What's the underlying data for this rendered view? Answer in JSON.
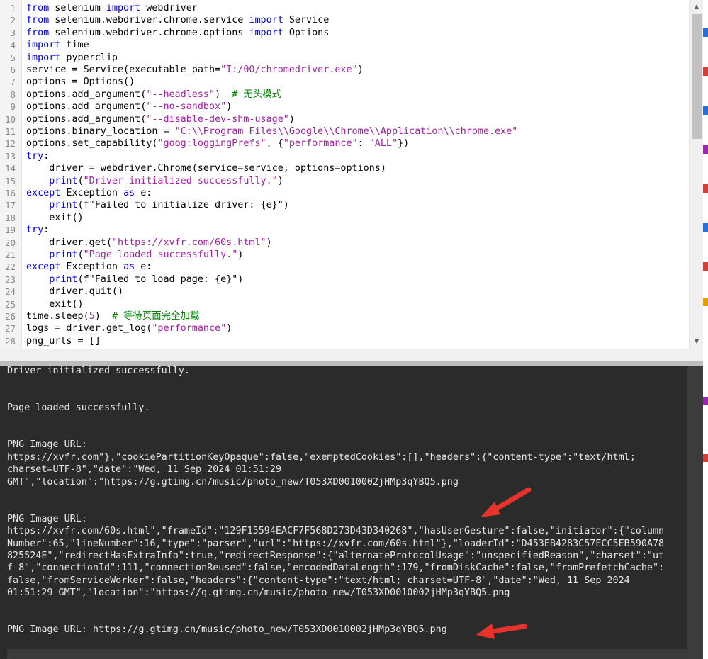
{
  "editor": {
    "lines": [
      {
        "n": "1",
        "tokens": [
          [
            "kw",
            "from"
          ],
          [
            "pl",
            " selenium "
          ],
          [
            "kw",
            "import"
          ],
          [
            "pl",
            " webdriver"
          ]
        ]
      },
      {
        "n": "2",
        "tokens": [
          [
            "kw",
            "from"
          ],
          [
            "pl",
            " selenium.webdriver.chrome.service "
          ],
          [
            "kw",
            "import"
          ],
          [
            "pl",
            " Service"
          ]
        ]
      },
      {
        "n": "3",
        "tokens": [
          [
            "kw",
            "from"
          ],
          [
            "pl",
            " selenium.webdriver.chrome.options "
          ],
          [
            "kw",
            "import"
          ],
          [
            "pl",
            " Options"
          ]
        ]
      },
      {
        "n": "4",
        "tokens": [
          [
            "kw",
            "import"
          ],
          [
            "pl",
            " time"
          ]
        ]
      },
      {
        "n": "5",
        "tokens": [
          [
            "kw",
            "import"
          ],
          [
            "pl",
            " pyperclip"
          ]
        ]
      },
      {
        "n": "6",
        "tokens": [
          [
            "pl",
            "service = Service(executable_path="
          ],
          [
            "str",
            "\"I:/00/chromedriver.exe\""
          ],
          [
            "pl",
            ")"
          ]
        ]
      },
      {
        "n": "7",
        "tokens": [
          [
            "pl",
            "options = Options()"
          ]
        ]
      },
      {
        "n": "8",
        "tokens": [
          [
            "pl",
            "options.add_argument("
          ],
          [
            "str",
            "\"--headless\""
          ],
          [
            "pl",
            ")  "
          ],
          [
            "cmt",
            "# 无头模式"
          ]
        ]
      },
      {
        "n": "9",
        "tokens": [
          [
            "pl",
            "options.add_argument("
          ],
          [
            "str",
            "\"--no-sandbox\""
          ],
          [
            "pl",
            ")"
          ]
        ]
      },
      {
        "n": "10",
        "tokens": [
          [
            "pl",
            "options.add_argument("
          ],
          [
            "str",
            "\"--disable-dev-shm-usage\""
          ],
          [
            "pl",
            ")"
          ]
        ]
      },
      {
        "n": "11",
        "tokens": [
          [
            "pl",
            "options.binary_location = "
          ],
          [
            "str",
            "\"C:\\\\Program Files\\\\Google\\\\Chrome\\\\Application\\\\chrome.exe\""
          ]
        ]
      },
      {
        "n": "12",
        "tokens": [
          [
            "pl",
            "options.set_capability("
          ],
          [
            "str",
            "\"goog:loggingPrefs\""
          ],
          [
            "pl",
            ", {"
          ],
          [
            "str",
            "\"performance\""
          ],
          [
            "pl",
            ": "
          ],
          [
            "str",
            "\"ALL\""
          ],
          [
            "pl",
            "})"
          ]
        ]
      },
      {
        "n": "13",
        "tokens": [
          [
            "kw",
            "try"
          ],
          [
            "pl",
            ":"
          ]
        ]
      },
      {
        "n": "14",
        "tokens": [
          [
            "pl",
            "    driver = webdriver.Chrome(service=service, options=options)"
          ]
        ]
      },
      {
        "n": "15",
        "tokens": [
          [
            "pl",
            "    "
          ],
          [
            "bi",
            "print"
          ],
          [
            "pl",
            "("
          ],
          [
            "str",
            "\"Driver initialized successfully.\""
          ],
          [
            "pl",
            ")"
          ]
        ]
      },
      {
        "n": "16",
        "tokens": [
          [
            "kw",
            "except"
          ],
          [
            "pl",
            " Exception "
          ],
          [
            "kw",
            "as"
          ],
          [
            "pl",
            " e:"
          ]
        ]
      },
      {
        "n": "17",
        "tokens": [
          [
            "pl",
            "    "
          ],
          [
            "bi",
            "print"
          ],
          [
            "pl",
            "(f\"Failed to initialize driver: {e}\")"
          ]
        ]
      },
      {
        "n": "18",
        "tokens": [
          [
            "pl",
            "    exit()"
          ]
        ]
      },
      {
        "n": "19",
        "tokens": [
          [
            "kw",
            "try"
          ],
          [
            "pl",
            ":"
          ]
        ]
      },
      {
        "n": "20",
        "tokens": [
          [
            "pl",
            "    driver.get("
          ],
          [
            "str",
            "\"https://xvfr.com/60s.html\""
          ],
          [
            "pl",
            ")"
          ]
        ]
      },
      {
        "n": "21",
        "tokens": [
          [
            "pl",
            "    "
          ],
          [
            "bi",
            "print"
          ],
          [
            "pl",
            "("
          ],
          [
            "str",
            "\"Page loaded successfully.\""
          ],
          [
            "pl",
            ")"
          ]
        ]
      },
      {
        "n": "22",
        "tokens": [
          [
            "kw",
            "except"
          ],
          [
            "pl",
            " Exception "
          ],
          [
            "kw",
            "as"
          ],
          [
            "pl",
            " e:"
          ]
        ]
      },
      {
        "n": "23",
        "tokens": [
          [
            "pl",
            "    "
          ],
          [
            "bi",
            "print"
          ],
          [
            "pl",
            "(f\"Failed to load page: {e}\")"
          ]
        ]
      },
      {
        "n": "24",
        "tokens": [
          [
            "pl",
            "    driver.quit()"
          ]
        ]
      },
      {
        "n": "25",
        "tokens": [
          [
            "pl",
            "    exit()"
          ]
        ]
      },
      {
        "n": "26",
        "tokens": [
          [
            "pl",
            "time.sleep("
          ],
          [
            "num",
            "5"
          ],
          [
            "pl",
            ")  "
          ],
          [
            "cmt",
            "# 等待页面完全加载"
          ]
        ]
      },
      {
        "n": "27",
        "tokens": [
          [
            "pl",
            "logs = driver.get_log("
          ],
          [
            "str",
            "\"performance\""
          ],
          [
            "pl",
            ")"
          ]
        ]
      },
      {
        "n": "28",
        "tokens": [
          [
            "pl",
            "png_urls = []"
          ]
        ]
      }
    ],
    "scroll_up_icon": "triangle-up",
    "scroll_down_icon": "triangle-down"
  },
  "console": {
    "lines": [
      "Driver initialized successfully.",
      "",
      "",
      "Page loaded successfully.",
      "",
      "",
      "PNG Image URL:",
      "https://xvfr.com\"},\"cookiePartitionKeyOpaque\":false,\"exemptedCookies\":[],\"headers\":{\"content-type\":\"text/html;",
      "charset=UTF-8\",\"date\":\"Wed, 11 Sep 2024 01:51:29",
      "GMT\",\"location\":\"https://g.gtimg.cn/music/photo_new/T053XD0010002jHMp3qYBQ5.png",
      "",
      "",
      "PNG Image URL:",
      "https://xvfr.com/60s.html\",\"frameId\":\"129F15594EACF7F568D273D43D340268\",\"hasUserGesture\":false,\"initiator\":{\"column",
      "Number\":65,\"lineNumber\":16,\"type\":\"parser\",\"url\":\"https://xvfr.com/60s.html\"},\"loaderId\":\"D453EB4283C57ECC5EB590A78",
      "825524E\",\"redirectHasExtraInfo\":true,\"redirectResponse\":{\"alternateProtocolUsage\":\"unspecifiedReason\",\"charset\":\"ut",
      "f-8\",\"connectionId\":111,\"connectionReused\":false,\"encodedDataLength\":179,\"fromDiskCache\":false,\"fromPrefetchCache\":",
      "false,\"fromServiceWorker\":false,\"headers\":{\"content-type\":\"text/html; charset=UTF-8\",\"date\":\"Wed, 11 Sep 2024",
      "01:51:29 GMT\",\"location\":\"https://g.gtimg.cn/music/photo_new/T053XD0010002jHMp3qYBQ5.png",
      "",
      "",
      "PNG Image URL: https://g.gtimg.cn/music/photo_new/T053XD0010002jHMp3qYBQ5.png"
    ]
  },
  "annotations": {
    "arrow_color": "#e8322b",
    "arrow_icon": "red-arrow"
  },
  "colors": {
    "keyword": "#0000ff",
    "string": "#a020a0",
    "comment": "#008000",
    "console_bg": "#2b2b2b",
    "console_text": "#e8e8e8"
  }
}
